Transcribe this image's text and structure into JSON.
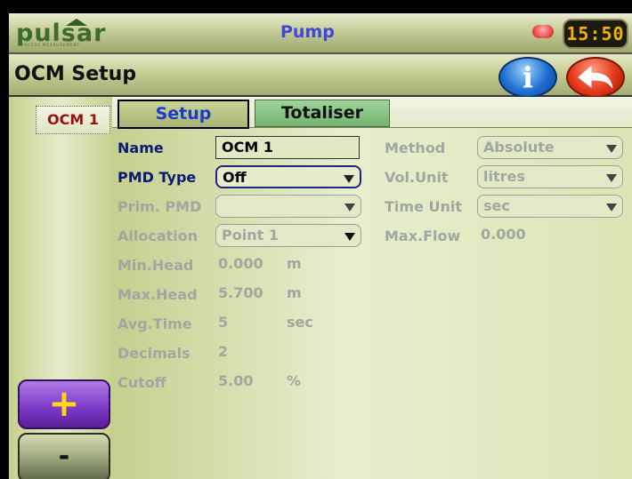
{
  "topbar": {
    "logo_text": "pulsar",
    "logo_subtext": "PROCESS MEASUREMENT",
    "title": "Pump",
    "clock": "15:50"
  },
  "header": {
    "page_title": "OCM Setup"
  },
  "sidebar": {
    "items": [
      {
        "label": "OCM 1"
      }
    ],
    "add_label": "+",
    "remove_label": "-"
  },
  "tabs": [
    {
      "label": "Setup",
      "active": true
    },
    {
      "label": "Totaliser",
      "active": false
    }
  ],
  "form": {
    "name": {
      "label": "Name",
      "value": "OCM 1"
    },
    "pmd_type": {
      "label": "PMD Type",
      "value": "Off"
    },
    "prim_pmd": {
      "label": "Prim. PMD",
      "value": ""
    },
    "allocation": {
      "label": "Allocation",
      "value": "Point 1"
    },
    "min_head": {
      "label": "Min.Head",
      "value": "0.000",
      "unit": "m"
    },
    "max_head": {
      "label": "Max.Head",
      "value": "5.700",
      "unit": "m"
    },
    "avg_time": {
      "label": "Avg.Time",
      "value": "5",
      "unit": "sec"
    },
    "decimals": {
      "label": "Decimals",
      "value": "2"
    },
    "cutoff": {
      "label": "Cutoff",
      "value": "5.00",
      "unit": "%"
    },
    "method": {
      "label": "Method",
      "value": "Absolute"
    },
    "vol_unit": {
      "label": "Vol.Unit",
      "value": "litres"
    },
    "time_unit": {
      "label": "Time Unit",
      "value": "sec"
    },
    "max_flow": {
      "label": "Max.Flow",
      "value": "0.000"
    }
  },
  "colors": {
    "accent_blue": "#3f46d8",
    "active_label": "#0b1b73",
    "disabled_text": "#a0a7a0",
    "ocm_item": "#9a1010",
    "clock_digits": "#f0b400"
  }
}
